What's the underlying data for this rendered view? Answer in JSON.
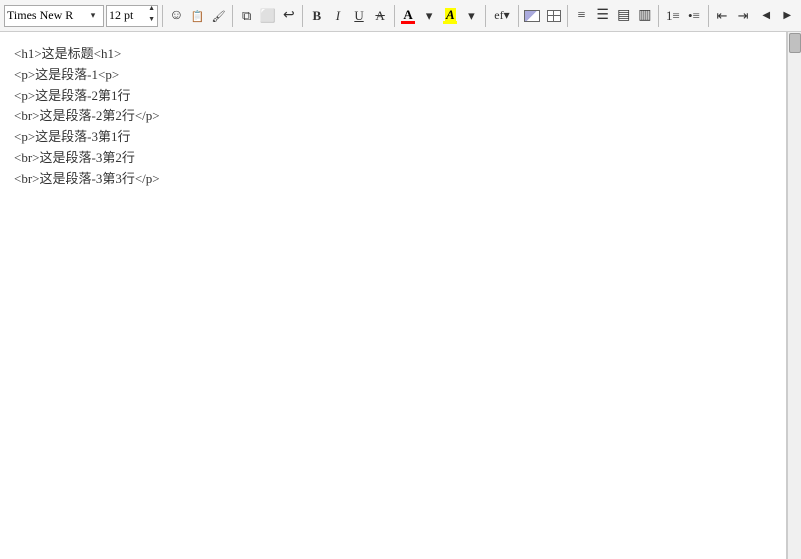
{
  "toolbar": {
    "font_name": "Times New R",
    "font_size": "12 pt",
    "buttons": {
      "bold": "B",
      "italic": "I",
      "underline": "U",
      "strikethrough": "A",
      "font_color": "A",
      "highlight": "A"
    },
    "align_left": "align-left",
    "align_center": "align-center",
    "align_right": "align-right",
    "align_justify": "align-justify",
    "list_ol": "list-ol",
    "list_ul": "list-ul",
    "indent_decrease": "indent-out",
    "indent_increase": "indent-in"
  },
  "editor": {
    "content_lines": [
      "<h1>这是标题<h1>",
      "<p>这是段落-1<p>",
      "<p>这是段落-2第1行",
      "<br>这是段落-2第2行</p>",
      "<p>这是段落-3第1行",
      "<br>这是段落-3第2行",
      "<br>这是段落-3第3行</p>"
    ]
  }
}
